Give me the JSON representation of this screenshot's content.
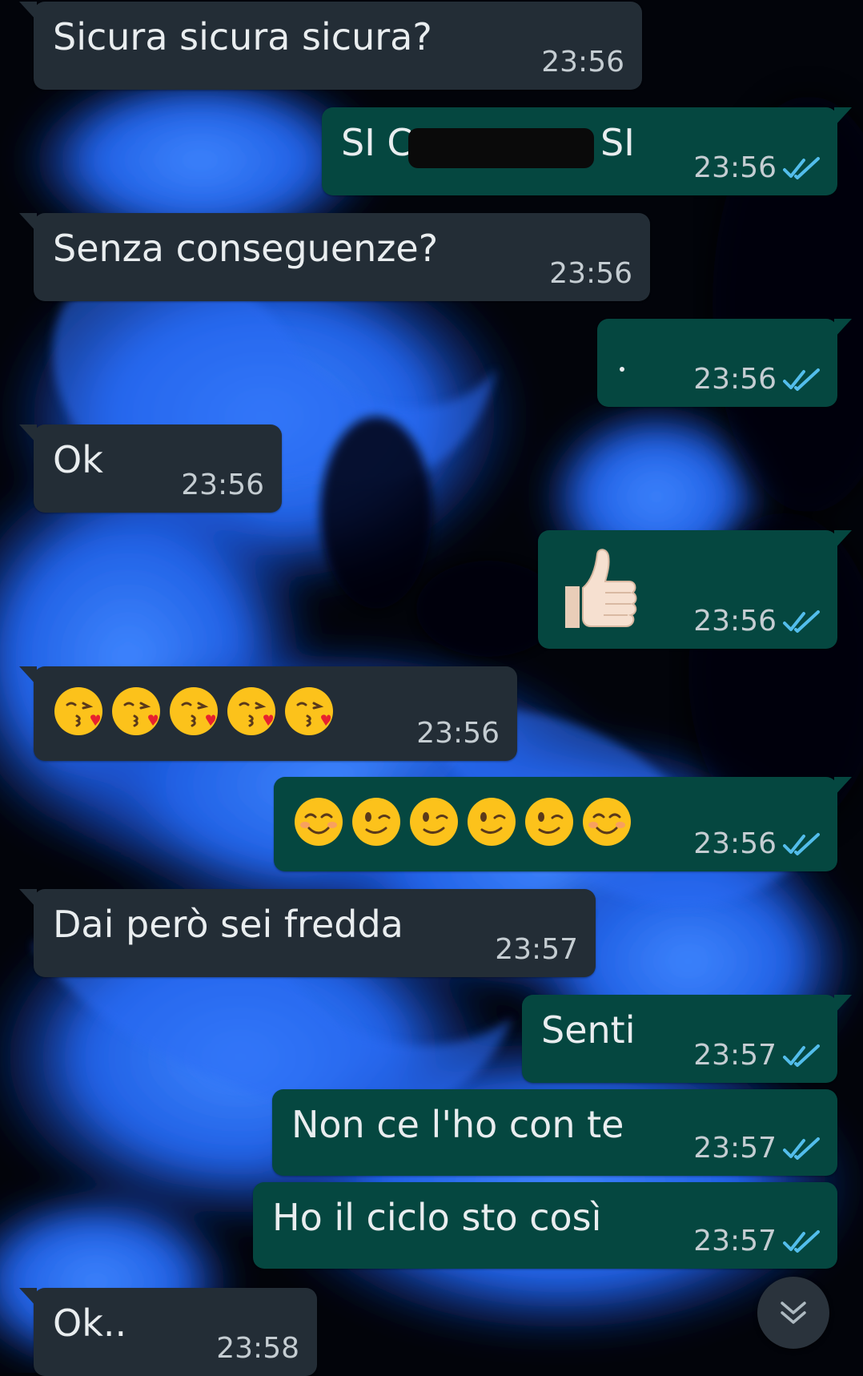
{
  "messages": [
    {
      "direction": "incoming",
      "text": "Sicura sicura sicura?",
      "time": "23:56"
    },
    {
      "direction": "outgoing",
      "text_start": "SI C",
      "text_end": "SI",
      "time": "23:56",
      "status": "read"
    },
    {
      "direction": "incoming",
      "text": "Senza conseguenze?",
      "time": "23:56"
    },
    {
      "direction": "outgoing",
      "text": "·",
      "time": "23:56",
      "status": "read"
    },
    {
      "direction": "incoming",
      "text": "Ok",
      "time": "23:56"
    },
    {
      "direction": "outgoing",
      "emoji": [
        "thumbs-up"
      ],
      "time": "23:56",
      "status": "read"
    },
    {
      "direction": "incoming",
      "emoji": [
        "face-blowing-kiss",
        "face-blowing-kiss",
        "face-blowing-kiss",
        "face-blowing-kiss",
        "face-blowing-kiss"
      ],
      "time": "23:56"
    },
    {
      "direction": "outgoing",
      "emoji": [
        "smiling-face",
        "winking-face",
        "winking-face",
        "winking-face",
        "winking-face",
        "smiling-face"
      ],
      "time": "23:56",
      "status": "read"
    },
    {
      "direction": "incoming",
      "text": "Dai però sei fredda",
      "time": "23:57"
    },
    {
      "direction": "outgoing",
      "text": "Senti",
      "time": "23:57",
      "status": "read"
    },
    {
      "direction": "outgoing",
      "text": "Non ce l'ho con te",
      "time": "23:57",
      "status": "read"
    },
    {
      "direction": "outgoing",
      "text": "Ho il ciclo sto così",
      "time": "23:57",
      "status": "read"
    },
    {
      "direction": "incoming",
      "text": "Ok..",
      "time": "23:58"
    }
  ],
  "colors": {
    "incoming_bubble": "#232d36",
    "outgoing_bubble": "#054740",
    "read_ticks": "#53bdeb",
    "wallpaper_blue": "#1e5fe0"
  },
  "icons": {
    "read_receipt": "double-check-icon",
    "scroll_down": "chevron-down-double-icon"
  }
}
